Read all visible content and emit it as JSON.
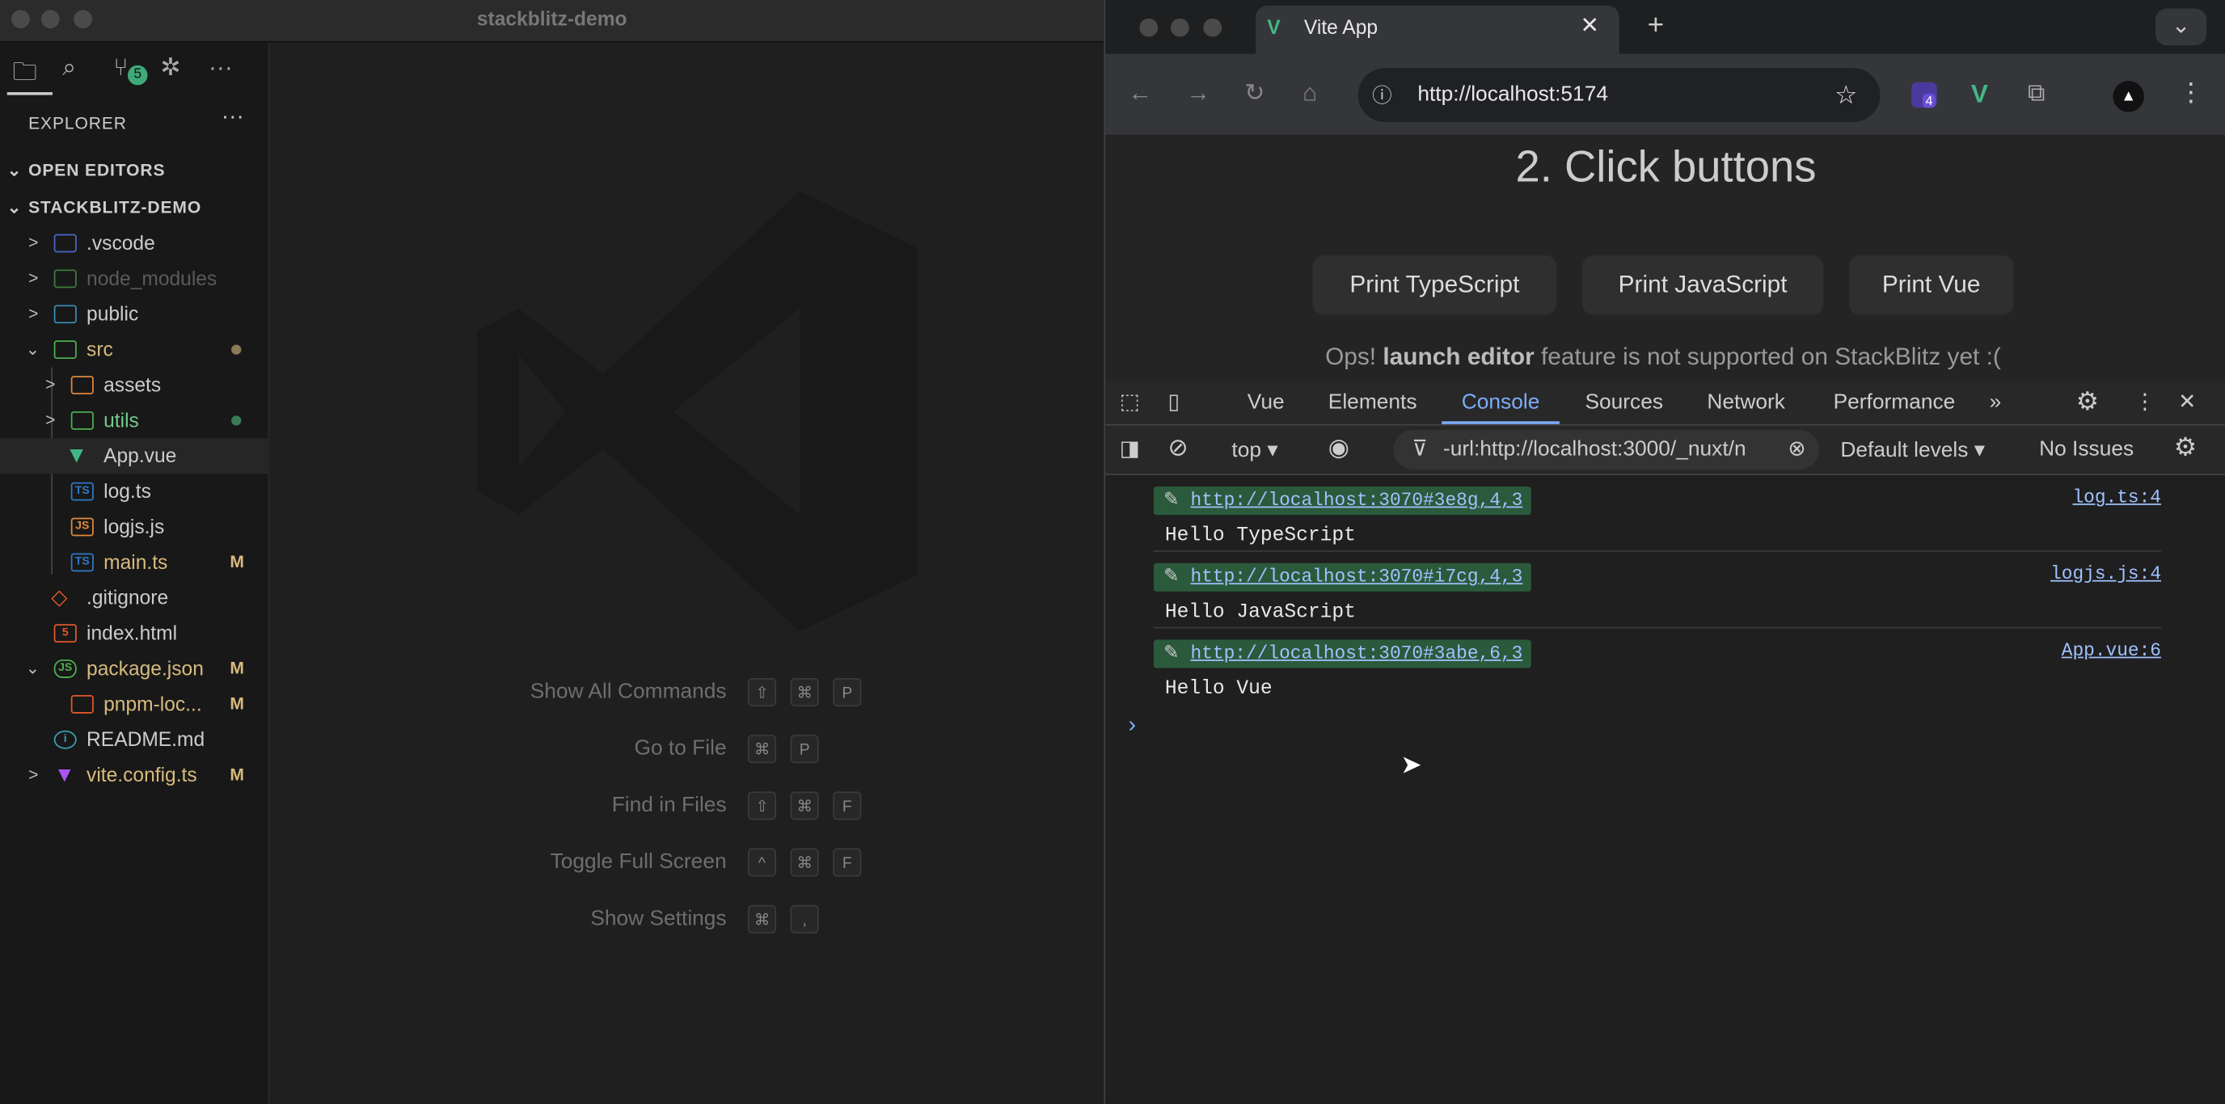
{
  "vscode": {
    "title": "stackblitz-demo",
    "scm_badge": "5",
    "explorer_label": "EXPLORER",
    "open_editors": "OPEN EDITORS",
    "project": "STACKBLITZ-DEMO",
    "tree": [
      {
        "name": ".vscode",
        "badge": ""
      },
      {
        "name": "node_modules",
        "badge": ""
      },
      {
        "name": "public",
        "badge": ""
      },
      {
        "name": "src",
        "badge": ""
      },
      {
        "name": "assets",
        "badge": ""
      },
      {
        "name": "utils",
        "badge": ""
      },
      {
        "name": "App.vue",
        "badge": ""
      },
      {
        "name": "log.ts",
        "badge": ""
      },
      {
        "name": "logjs.js",
        "badge": ""
      },
      {
        "name": "main.ts",
        "badge": "M"
      },
      {
        "name": ".gitignore",
        "badge": ""
      },
      {
        "name": "index.html",
        "badge": ""
      },
      {
        "name": "package.json",
        "badge": "M"
      },
      {
        "name": "pnpm-loc...",
        "badge": "M"
      },
      {
        "name": "README.md",
        "badge": ""
      },
      {
        "name": "vite.config.ts",
        "badge": "M"
      }
    ],
    "shortcuts": [
      {
        "label": "Show All Commands",
        "keys": [
          "⇧",
          "⌘",
          "P"
        ]
      },
      {
        "label": "Go to File",
        "keys": [
          "⌘",
          "P"
        ]
      },
      {
        "label": "Find in Files",
        "keys": [
          "⇧",
          "⌘",
          "F"
        ]
      },
      {
        "label": "Toggle Full Screen",
        "keys": [
          "^",
          "⌘",
          "F"
        ]
      },
      {
        "label": "Show Settings",
        "keys": [
          "⌘",
          ","
        ]
      }
    ]
  },
  "browser": {
    "tab_title": "Vite App",
    "url": "http://localhost:5174",
    "ext_badge": "4",
    "page": {
      "heading": "2. Click buttons",
      "buttons": [
        "Print TypeScript",
        "Print JavaScript",
        "Print Vue"
      ],
      "note_pre": "Ops! ",
      "note_bold": "launch editor",
      "note_post": " feature is not supported on StackBlitz yet :("
    },
    "devtools": {
      "tabs": [
        "Vue",
        "Elements",
        "Console",
        "Sources",
        "Network",
        "Performance"
      ],
      "active_tab": "Console",
      "context": "top",
      "filter": "-url:http://localhost:3000/_nuxt/n",
      "levels": "Default levels",
      "issues": "No Issues",
      "messages": [
        {
          "link": "http://localhost:3070#3e8g,4,3",
          "text": "Hello TypeScript",
          "source": "log.ts:4"
        },
        {
          "link": "http://localhost:3070#i7cg,4,3",
          "text": "Hello JavaScript",
          "source": "logjs.js:4"
        },
        {
          "link": "http://localhost:3070#3abe,6,3",
          "text": "Hello Vue",
          "source": "App.vue:6"
        }
      ],
      "prompt": "›"
    }
  },
  "colors": {
    "accent": "#7cacf8",
    "vue_green": "#41b883",
    "modified": "#d7ba7d"
  }
}
